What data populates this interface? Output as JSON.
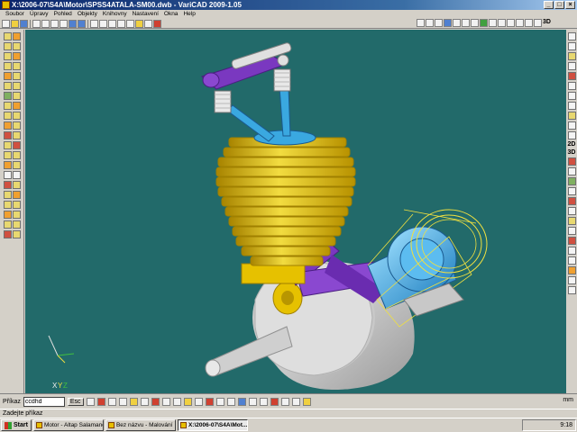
{
  "window": {
    "title": "X:\\2006-07\\S4A\\Motor\\SPSS4ATALA-SM00.dwb - VariCAD 2009-1.05"
  },
  "menu": [
    "Soubor",
    "Úpravy",
    "Pohled",
    "Objekty",
    "Knihovny",
    "Nastavení",
    "Okna",
    "Help"
  ],
  "right_labels": {
    "top": "3D",
    "view_2d": "2D",
    "view_3d": "3D"
  },
  "viewport": {
    "background": "#226a6a",
    "axes": {
      "x": "X",
      "y": "Y",
      "z": "Z"
    }
  },
  "command": {
    "label": "Příkaz",
    "value": "ccdhd",
    "esc": "Esc",
    "units": "mm",
    "prompt": "Zadejte příkaz"
  },
  "taskbar": {
    "start": "Start",
    "tasks": [
      {
        "label": "Motor - Altap Salamande...",
        "active": false
      },
      {
        "label": "Bez názvu - Malování",
        "active": false
      },
      {
        "label": "X:\\2006-07\\S4A\\Mot...",
        "active": true
      }
    ],
    "clock": "9:18"
  },
  "colors": {
    "cylinder": "#e6c100",
    "piston": "#3aa8e0",
    "rod": "#7a38c0",
    "crank": "#d0d0d0",
    "selection": "#f0e040"
  }
}
